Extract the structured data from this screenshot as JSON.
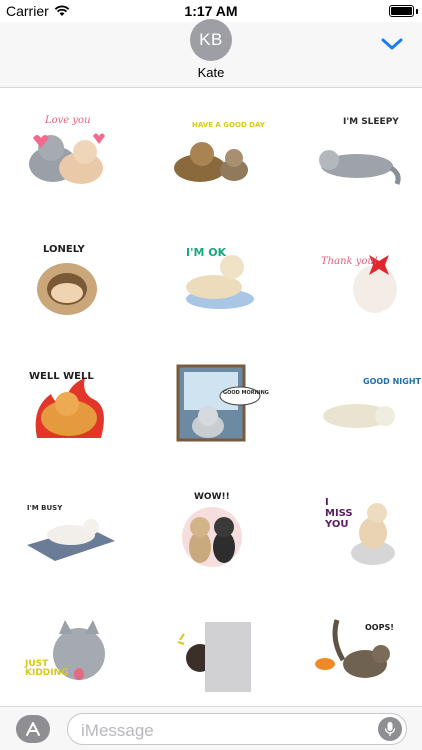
{
  "status_bar": {
    "carrier": "Carrier",
    "time": "1:17 AM",
    "battery_level": 1.0
  },
  "header": {
    "avatar_initials": "KB",
    "contact_name": "Kate",
    "collapse_icon": "chevron-down-icon",
    "accent_color": "#1a7cf5"
  },
  "stickers": [
    {
      "caption": "Love you"
    },
    {
      "caption": "HAVE A GOOD DAY"
    },
    {
      "caption": "I'M SLEEPY"
    },
    {
      "caption": "LONELY"
    },
    {
      "caption": "I'M OK"
    },
    {
      "caption": "Thank you!"
    },
    {
      "caption": "WELL WELL"
    },
    {
      "caption": "GOOD MORNING"
    },
    {
      "caption": "GOOD NIGHT"
    },
    {
      "caption": "I'M BUSY"
    },
    {
      "caption": "WOW!!"
    },
    {
      "caption": "I MISS YOU"
    },
    {
      "caption": "JUST KIDDING"
    },
    {
      "caption": ""
    },
    {
      "caption": "OOPS!"
    }
  ],
  "input_bar": {
    "apps_icon": "app-store-icon",
    "placeholder": "iMessage",
    "mic_icon": "microphone-icon"
  }
}
